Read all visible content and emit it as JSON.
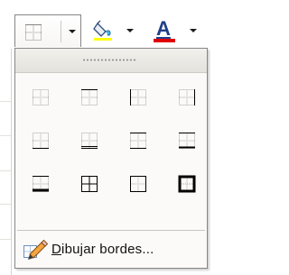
{
  "toolbar": {
    "borders_button": "borders-dropdown",
    "fill_button": "fill-color-dropdown",
    "font_color_button": "font-color-dropdown",
    "font_color_glyph": "A",
    "font_color_swatch": "#e00000",
    "fill_color_swatch": "#ffff00"
  },
  "menu": {
    "border_options": [
      "bottom-border",
      "top-border",
      "left-border",
      "right-border",
      "no-border",
      "all-borders",
      "outside-borders",
      "thick-box-border",
      "bottom-double-border",
      "thick-bottom-border",
      "top-and-bottom-border",
      "top-and-thick-bottom-border"
    ],
    "draw_borders_label": "Dibujar bordes...",
    "draw_borders_mnemonic": "D"
  }
}
